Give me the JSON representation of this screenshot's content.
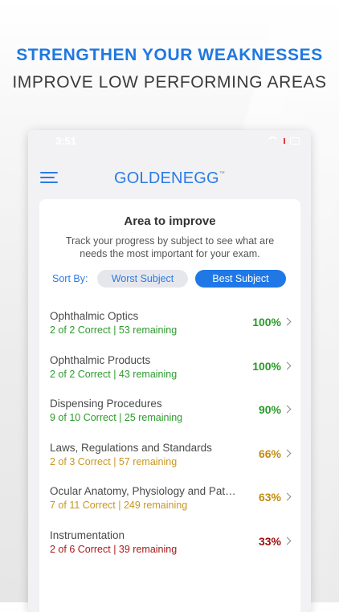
{
  "promo": {
    "headline": "STRENGTHEN YOUR WEAKNESSES",
    "subheadline": "IMPROVE LOW PERFORMING AREAS"
  },
  "status_bar": {
    "time": "3:51"
  },
  "app": {
    "logo_text": "GOLDENEGG",
    "logo_mark": "™"
  },
  "area": {
    "title": "Area to improve",
    "description": "Track your progress by subject to see what are needs the most important for your exam."
  },
  "sort": {
    "label": "Sort By:",
    "options": [
      "Worst Subject",
      "Best Subject"
    ],
    "selected": "Best Subject"
  },
  "subjects": [
    {
      "name": "Ophthalmic Optics",
      "stats": "2 of 2 Correct | 53 remaining",
      "percent": "100%"
    },
    {
      "name": "Ophthalmic Products",
      "stats": "2 of 2 Correct | 43 remaining",
      "percent": "100%"
    },
    {
      "name": "Dispensing Procedures",
      "stats": "9 of 10 Correct | 25 remaining",
      "percent": "90%"
    },
    {
      "name": "Laws, Regulations and Standards",
      "stats": "2 of 3 Correct | 57 remaining",
      "percent": "66%"
    },
    {
      "name": "Ocular Anatomy, Physiology and Pat…",
      "stats": "7 of 11 Correct | 249 remaining",
      "percent": "63%"
    },
    {
      "name": "Instrumentation",
      "stats": "2 of 6 Correct | 39 remaining",
      "percent": "33%"
    }
  ],
  "colors": {
    "accent": "#1f78e6",
    "good": "#2a9a28",
    "medium": "#c28c10",
    "poor": "#a00f0f"
  }
}
